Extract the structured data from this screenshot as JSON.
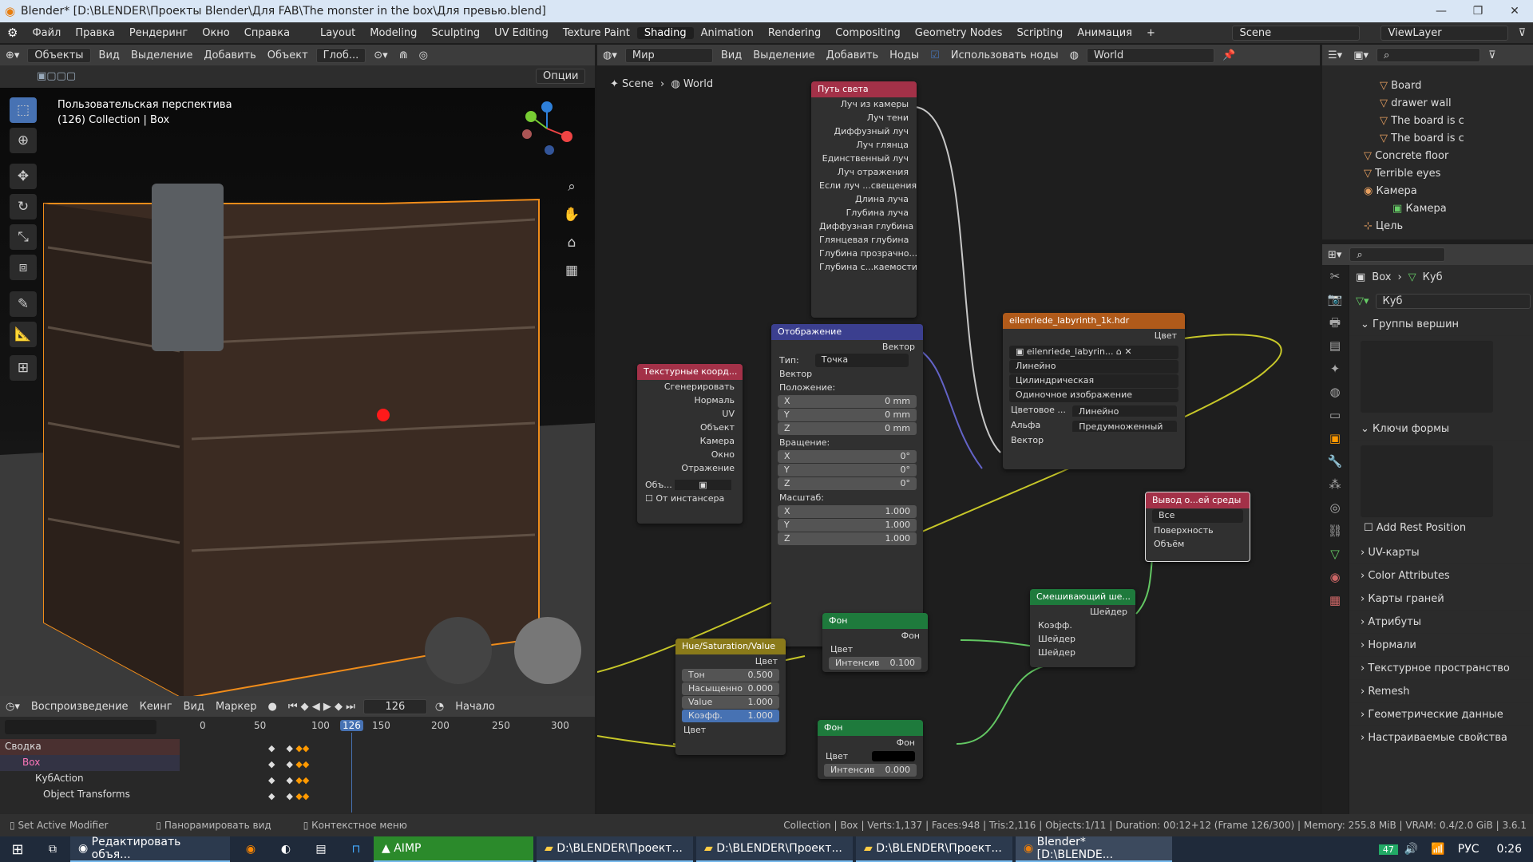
{
  "window": {
    "title": "Blender* [D:\\BLENDER\\Проекты Blender\\Для FAB\\The monster in the box\\Для превью.blend]"
  },
  "menu": [
    "Файл",
    "Правка",
    "Рендеринг",
    "Окно",
    "Справка"
  ],
  "workspaces": [
    "Layout",
    "Modeling",
    "Sculpting",
    "UV Editing",
    "Texture Paint",
    "Shading",
    "Animation",
    "Rendering",
    "Compositing",
    "Geometry Nodes",
    "Scripting",
    "Анимация",
    "+"
  ],
  "scene": {
    "label": "Scene",
    "viewlayer": "ViewLayer"
  },
  "viewport": {
    "mode": "Объекты",
    "menus": [
      "Вид",
      "Выделение",
      "Добавить",
      "Объект"
    ],
    "orientation": "Глоб...",
    "options": "Опции",
    "info1": "Пользовательская перспектива",
    "info2": "(126) Collection | Box"
  },
  "node_header": {
    "world_type": "Мир",
    "menus": [
      "Вид",
      "Выделение",
      "Добавить",
      "Ноды"
    ],
    "use_nodes": "Использовать ноды",
    "world": "World"
  },
  "breadcrumb": [
    "Scene",
    "World"
  ],
  "nodes": {
    "light_path": {
      "title": "Путь света",
      "rows": [
        "Луч из камеры",
        "Луч тени",
        "Диффузный луч",
        "Луч глянца",
        "Единственный луч",
        "Луч отражения",
        "Если луч ...свещения",
        "Длина луча",
        "Глубина луча",
        "Диффузная глубина",
        "Глянцевая глубина",
        "Глубина прозрачно...",
        "Глубина с...каемости"
      ]
    },
    "tex_coord": {
      "title": "Текстурные коорд...",
      "rows": [
        "Сгенерировать",
        "Нормаль",
        "UV",
        "Объект",
        "Камера",
        "Окно",
        "Отражение"
      ],
      "obj_label": "Объ...",
      "from_instancer": "От инстансера"
    },
    "mapping": {
      "title": "Отображение",
      "out": "Вектор",
      "type_label": "Тип:",
      "type": "Точка",
      "vector": "Вектор",
      "loc": "Положение:",
      "rot": "Вращение:",
      "scale": "Масштаб:",
      "loc_vals": [
        "0 mm",
        "0 mm",
        "0 mm"
      ],
      "rot_vals": [
        "0°",
        "0°",
        "0°"
      ],
      "scale_vals": [
        "1.000",
        "1.000",
        "1.000"
      ]
    },
    "env": {
      "title": "eilenriede_labyrinth_1k.hdr",
      "out": "Цвет",
      "image": "eilenriede_labyrin...",
      "interp": "Линейно",
      "proj": "Цилиндрическая",
      "src": "Одиночное изображение",
      "cs_label": "Цветовое ...",
      "cs": "Линейно",
      "alpha_label": "Альфа",
      "alpha": "Предумноженный",
      "vec": "Вектор"
    },
    "output": {
      "title": "Вывод о...ей среды",
      "target": "Все",
      "surface": "Поверхность",
      "volume": "Объём"
    },
    "mix": {
      "title": "Смешивающий ше...",
      "out": "Шейдер",
      "fac": "Коэфф.",
      "s1": "Шейдер",
      "s2": "Шейдер"
    },
    "bg1": {
      "title": "Фон",
      "out": "Фон",
      "color": "Цвет",
      "strength": "Интенсив",
      "strength_val": "0.100"
    },
    "bg2": {
      "title": "Фон",
      "out": "Фон",
      "color": "Цвет",
      "strength": "Интенсив",
      "strength_val": "0.000"
    },
    "hsv": {
      "title": "Hue/Saturation/Value",
      "out": "Цвет",
      "hue": "Тон",
      "hue_val": "0.500",
      "sat": "Насыщенно",
      "sat_val": "0.000",
      "val": "Value",
      "val_val": "1.000",
      "fac": "Коэфф.",
      "fac_val": "1.000",
      "color": "Цвет"
    }
  },
  "outliner": [
    {
      "name": "Board"
    },
    {
      "name": "drawer wall"
    },
    {
      "name": "The board is c"
    },
    {
      "name": "The board is c"
    },
    {
      "name": "Concrete floor"
    },
    {
      "name": "Terrible eyes"
    },
    {
      "name": "Камера"
    },
    {
      "name": "Камера"
    },
    {
      "name": "Цель"
    }
  ],
  "properties": {
    "crumb1": "Box",
    "crumb2": "Куб",
    "mesh": "Куб",
    "vertex_groups": "Группы вершин",
    "shape_keys": "Ключи формы",
    "rest_position": "Add Rest Position",
    "sections": [
      "UV-карты",
      "Color Attributes",
      "Карты граней",
      "Атрибуты",
      "Нормали",
      "Текстурное пространство",
      "Remesh",
      "Геометрические данные",
      "Настраиваемые свойства"
    ]
  },
  "timeline": {
    "playback": "Воспроизведение",
    "keying": "Кеинг",
    "view": "Вид",
    "marker": "Маркер",
    "frame": "126",
    "start": "Начало",
    "ticks": [
      "0",
      "50",
      "100",
      "126",
      "150",
      "200",
      "250",
      "300"
    ],
    "rows": [
      "Сводка",
      "Box",
      "КубAction",
      "Object Transforms"
    ]
  },
  "status": {
    "left": "Set Active Modifier",
    "mid": "Панорамировать вид",
    "ctx": "Контекстное меню",
    "right": "Collection | Box | Verts:1,137 | Faces:948 | Tris:2,116 | Objects:1/11 | Duration: 00:12+12 (Frame 126/300) | Memory: 255.8 MiB | VRAM: 0.4/2.0 GiB | 3.6.1"
  },
  "taskbar": {
    "items": [
      "Редактировать объя...",
      "AIMP",
      "D:\\BLENDER\\Проект...",
      "D:\\BLENDER\\Проект...",
      "D:\\BLENDER\\Проект...",
      "Blender* [D:\\BLENDE..."
    ],
    "lang": "РУС",
    "time": "0:26",
    "badge": "47"
  }
}
